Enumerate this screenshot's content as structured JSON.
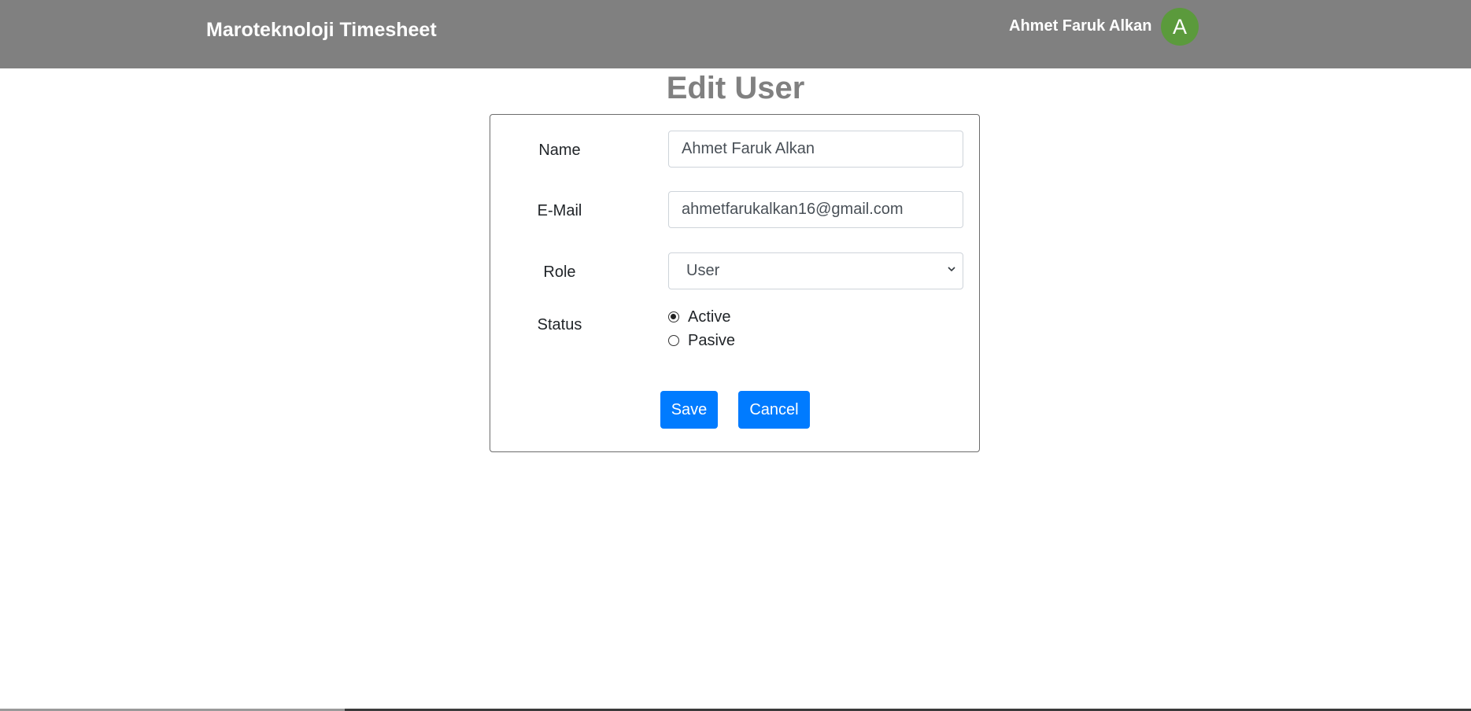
{
  "header": {
    "brand": "Maroteknoloji Timesheet",
    "user_name": "Ahmet Faruk Alkan",
    "avatar_initial": "A",
    "avatar_color": "#5b9a3c",
    "background_color": "#808080"
  },
  "page": {
    "title": "Edit User"
  },
  "form": {
    "name_label": "Name",
    "name_value": "Ahmet Faruk Alkan",
    "email_label": "E-Mail",
    "email_value": "ahmetfarukalkan16@gmail.com",
    "role_label": "Role",
    "role_value": "User",
    "status_label": "Status",
    "status_options": [
      {
        "label": "Active",
        "checked": true
      },
      {
        "label": "Pasive",
        "checked": false
      }
    ],
    "save_label": "Save",
    "cancel_label": "Cancel",
    "button_color": "#007bff"
  }
}
